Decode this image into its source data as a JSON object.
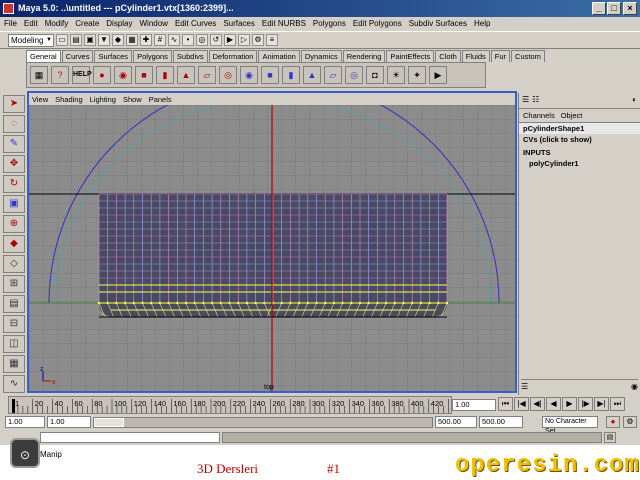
{
  "window": {
    "title": "Maya 5.0: ..\\untitled   ---   pCylinder1.vtx[1360:2399]...",
    "min": "_",
    "max": "□",
    "close": "×"
  },
  "menu": [
    "File",
    "Edit",
    "Modify",
    "Create",
    "Display",
    "Window",
    "Edit Curves",
    "Surfaces",
    "Edit NURBS",
    "Polygons",
    "Edit Polygons",
    "Subdiv Surfaces",
    "Help"
  ],
  "status": {
    "mode": "Modeling"
  },
  "shelf_tabs": [
    "General",
    "Curves",
    "Surfaces",
    "Polygons",
    "Subdivs",
    "Deformation",
    "Animation",
    "Dynamics",
    "Rendering",
    "PaintEffects",
    "Cloth",
    "Fluids",
    "Fur",
    "Custom"
  ],
  "shelf": {
    "help_label": "HELP"
  },
  "panel": {
    "menu": [
      "View",
      "Shading",
      "Lighting",
      "Show",
      "Panels"
    ],
    "camera": "top",
    "axis_x": "x",
    "axis_z": "z"
  },
  "channel_box": {
    "tabs": [
      "Channels",
      "Object"
    ],
    "shape": "pCylinderShape1",
    "cvs": "CVs (click to show)",
    "inputs": "INPUTS",
    "input_node": "polyCylinder1"
  },
  "timeline": {
    "ticks": [
      "1",
      "20",
      "40",
      "60",
      "80",
      "100",
      "120",
      "140",
      "160",
      "180",
      "200",
      "220",
      "240",
      "260",
      "280",
      "300",
      "320",
      "340",
      "360",
      "380",
      "400",
      "420"
    ],
    "current": "1.00"
  },
  "range": {
    "start": "1.00",
    "min": "1.00",
    "end": "500.00",
    "max": "500.00",
    "charset": "No Character Set"
  },
  "help": {
    "text": "Manip"
  },
  "caption": {
    "text": "3D Dersleri",
    "num": "#1"
  },
  "brand": "operesin.com"
}
